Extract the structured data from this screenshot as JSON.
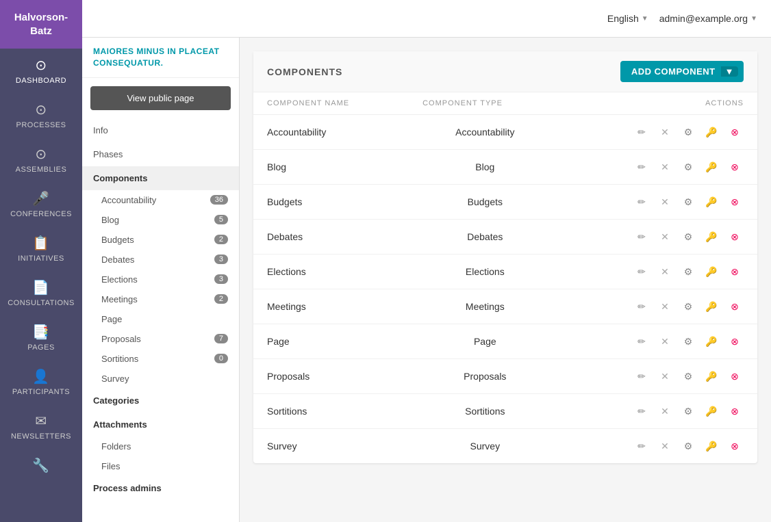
{
  "app": {
    "logo_text": "Halvorson-Batz"
  },
  "header": {
    "language": "English",
    "user": "admin@example.org"
  },
  "page_banner": "MAIORES MINUS IN PLACEAT CONSEQUATUR.",
  "secondary_nav": {
    "view_public_label": "View public page",
    "items": [
      {
        "label": "Info",
        "active": false
      },
      {
        "label": "Phases",
        "active": false
      },
      {
        "label": "Components",
        "active": true
      }
    ],
    "sub_items": [
      {
        "label": "Accountability",
        "count": "36"
      },
      {
        "label": "Blog",
        "count": "5"
      },
      {
        "label": "Budgets",
        "count": "2"
      },
      {
        "label": "Debates",
        "count": "3"
      },
      {
        "label": "Elections",
        "count": "3"
      },
      {
        "label": "Meetings",
        "count": "2"
      },
      {
        "label": "Page",
        "count": null
      },
      {
        "label": "Proposals",
        "count": "7"
      },
      {
        "label": "Sortitions",
        "count": "0"
      },
      {
        "label": "Survey",
        "count": null
      }
    ],
    "sections": [
      {
        "label": "Categories"
      },
      {
        "label": "Attachments"
      },
      {
        "label": "Folders"
      },
      {
        "label": "Files"
      },
      {
        "label": "Process admins"
      }
    ]
  },
  "sidebar_items": [
    {
      "label": "DASHBOARD",
      "icon": "⊙",
      "active": false
    },
    {
      "label": "PROCESSES",
      "icon": "⊙",
      "active": true
    },
    {
      "label": "ASSEMBLIES",
      "icon": "⊙",
      "active": false
    },
    {
      "label": "CONFERENCES",
      "icon": "🎤",
      "active": false
    },
    {
      "label": "INITIATIVES",
      "icon": "📋",
      "active": false
    },
    {
      "label": "CONSULTATIONS",
      "icon": "📄",
      "active": false
    },
    {
      "label": "PAGES",
      "icon": "📑",
      "active": false
    },
    {
      "label": "PARTICIPANTS",
      "icon": "👤",
      "active": false
    },
    {
      "label": "NEWSLETTERS",
      "icon": "✉",
      "active": false
    },
    {
      "label": "⚙",
      "icon": "🔧",
      "active": false
    }
  ],
  "components_section": {
    "title": "COMPONENTS",
    "add_button_label": "ADD COMPONENT",
    "table_headers": {
      "name": "COMPONENT NAME",
      "type": "COMPONENT TYPE",
      "actions": "ACTIONS"
    },
    "rows": [
      {
        "name": "Accountability",
        "type": "Accountability"
      },
      {
        "name": "Blog",
        "type": "Blog"
      },
      {
        "name": "Budgets",
        "type": "Budgets"
      },
      {
        "name": "Debates",
        "type": "Debates"
      },
      {
        "name": "Elections",
        "type": "Elections"
      },
      {
        "name": "Meetings",
        "type": "Meetings"
      },
      {
        "name": "Page",
        "type": "Page"
      },
      {
        "name": "Proposals",
        "type": "Proposals"
      },
      {
        "name": "Sortitions",
        "type": "Sortitions"
      },
      {
        "name": "Survey",
        "type": "Survey"
      }
    ]
  }
}
